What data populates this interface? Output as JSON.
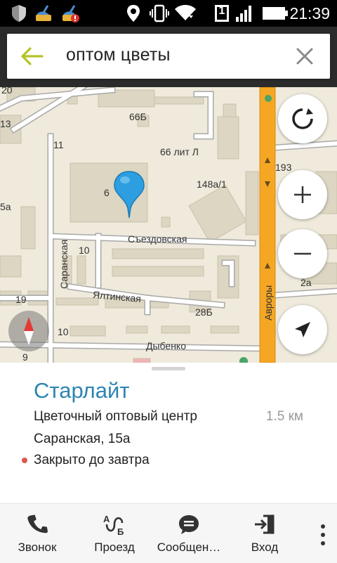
{
  "status_bar": {
    "time": "21:39",
    "sim_number": "1",
    "icons": [
      "shield-icon",
      "cleaner-icon",
      "cleaner-alert-icon",
      "location-icon",
      "vibrate-icon",
      "wifi-icon",
      "sim-icon",
      "signal-icon",
      "battery-icon"
    ]
  },
  "search": {
    "query": "оптом цветы",
    "back_icon": "back-arrow-icon",
    "clear_icon": "close-icon",
    "accent_color": "#b5c424"
  },
  "map": {
    "labels": {
      "n20": "20",
      "n13": "13",
      "n66b": "66Б",
      "n11": "11",
      "n66litl": "66 лит Л",
      "n193": "193",
      "n6": "6",
      "n148a1": "148а/1",
      "sa": "5а",
      "saranskaya": "Саранская",
      "sezdovskaya": "Съездовская",
      "n10a": "10",
      "n2a": "2а",
      "avrory": "Авроры",
      "n19": "19",
      "yaltinskaya": "Ялтинская",
      "n28b": "28Б",
      "n10b": "10",
      "dybenko": "Дыбенко",
      "n9": "9"
    },
    "controls": [
      "follow-location-icon",
      "zoom-in-icon",
      "zoom-out-icon",
      "navigate-arrow-icon"
    ],
    "compass_icon": "compass-icon",
    "pin_color": "#2d9fe0",
    "road_highlight_color": "#f5a623"
  },
  "place": {
    "name": "Старлайт",
    "category": "Цветочный оптовый центр",
    "distance": "1.5 км",
    "address": "Саранская, 15а",
    "status": "Закрыто до завтра",
    "status_color": "#e0574c"
  },
  "actions": [
    {
      "label": "Звонок",
      "icon": "phone-icon"
    },
    {
      "label": "Проезд",
      "icon": "route-icon"
    },
    {
      "label": "Сообщен…",
      "icon": "message-icon"
    },
    {
      "label": "Вход",
      "icon": "entrance-icon"
    }
  ],
  "more_icon": "more-vertical-icon"
}
